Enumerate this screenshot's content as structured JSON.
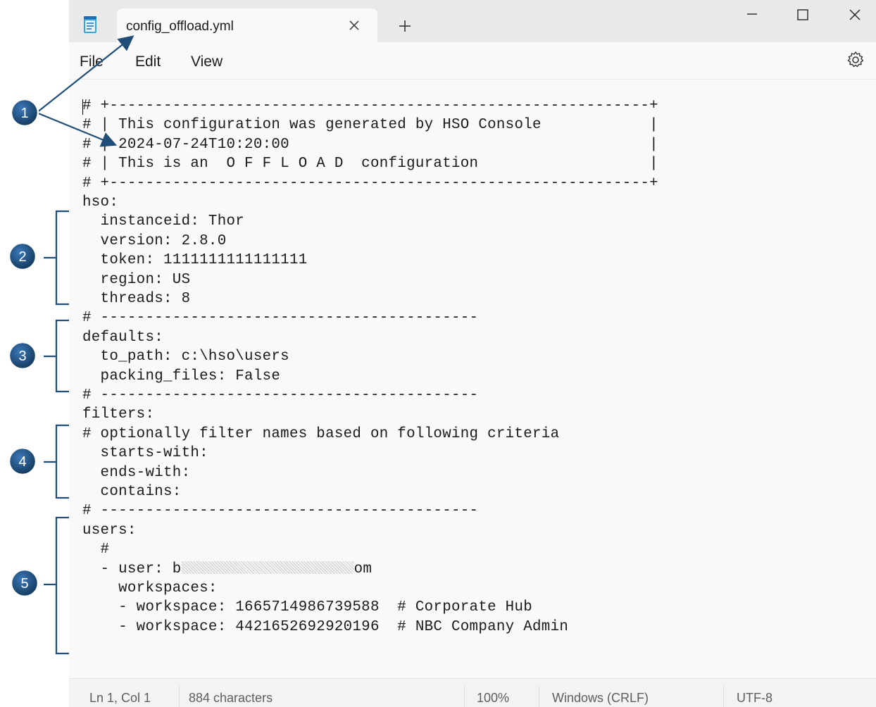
{
  "tab": {
    "title": "config_offload.yml"
  },
  "menu": {
    "file": "File",
    "edit": "Edit",
    "view": "View"
  },
  "editor": {
    "lines": [
      "# +------------------------------------------------------------+",
      "# | This configuration was generated by HSO Console            |",
      "# | 2024-07-24T10:20:00                                        |",
      "# | This is an  O F F L O A D  configuration                   |",
      "# +------------------------------------------------------------+",
      "hso:",
      "  instanceid: Thor",
      "  version: 2.8.0",
      "  token: 1111111111111111",
      "  region: US",
      "  threads: 8",
      "# ------------------------------------------",
      "defaults:",
      "  to_path: c:\\hso\\users",
      "  packing_files: False",
      "# ------------------------------------------",
      "filters:",
      "# optionally filter names based on following criteria",
      "  starts-with:",
      "  ends-with:",
      "  contains:",
      "# ------------------------------------------",
      "users:",
      "  #",
      "  - user: b",
      "    workspaces:",
      "    - workspace: 1665714986739588  # Corporate Hub",
      "    - workspace: 4421652692920196  # NBC Company Admin"
    ],
    "user_suffix": "om"
  },
  "status": {
    "position": "Ln 1, Col 1",
    "characters": "884 characters",
    "zoom": "100%",
    "line_ending": "Windows (CRLF)",
    "encoding": "UTF-8"
  },
  "callouts": [
    "1",
    "2",
    "3",
    "4",
    "5"
  ],
  "colors": {
    "callout_fill": "#1f4e79",
    "annotation_line": "#1f4e79"
  }
}
